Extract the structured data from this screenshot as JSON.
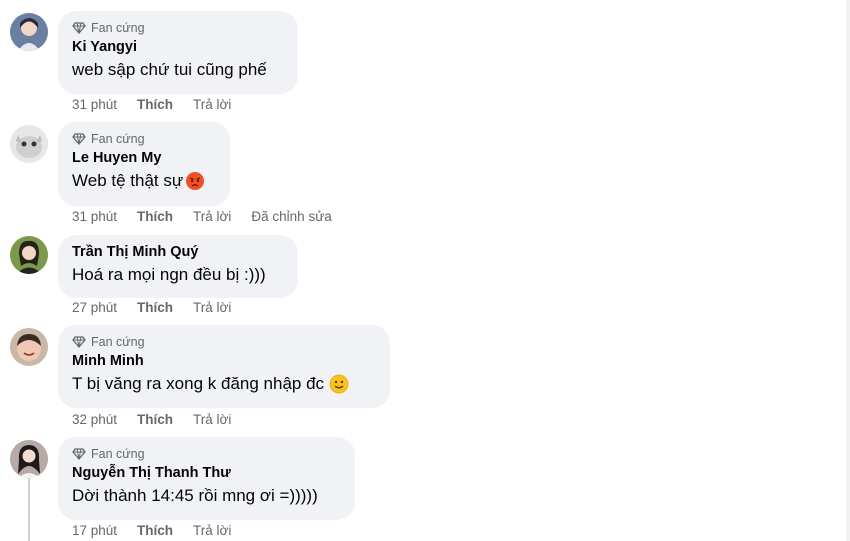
{
  "comments": [
    {
      "badge": "Fan cứng",
      "author": "Ki Yangyi",
      "text": "web sập chứ tui cũng phế",
      "time": "31 phút",
      "like": "Thích",
      "reply": "Trả lời",
      "edited": "",
      "emoji": ""
    },
    {
      "badge": "Fan cứng",
      "author": "Le Huyen My",
      "text": "Web tệ thật sự",
      "time": "31 phút",
      "like": "Thích",
      "reply": "Trả lời",
      "edited": "Đã chỉnh sửa",
      "emoji": "angry-face-icon"
    },
    {
      "badge": "",
      "author": "Trần Thị Minh Quý",
      "text": "Hoá ra mọi ngn đều bị :)))",
      "time": "27 phút",
      "like": "Thích",
      "reply": "Trả lời",
      "edited": "",
      "emoji": ""
    },
    {
      "badge": "Fan cứng",
      "author": "Minh Minh",
      "text": "T bị văng ra xong k đăng nhập đc",
      "time": "32 phút",
      "like": "Thích",
      "reply": "Trả lời",
      "edited": "",
      "emoji": "slight-smile-icon"
    },
    {
      "badge": "Fan cứng",
      "author": "Nguyễn Thị Thanh Thư",
      "text": "Dời thành 14:45 rồi mng ơi =)))))",
      "time": "17 phút",
      "like": "Thích",
      "reply": "Trả lời",
      "edited": "",
      "emoji": ""
    }
  ],
  "colors": {
    "bubble": "#f0f2f5",
    "secondary_text": "#65676b",
    "primary_text": "#050505"
  }
}
